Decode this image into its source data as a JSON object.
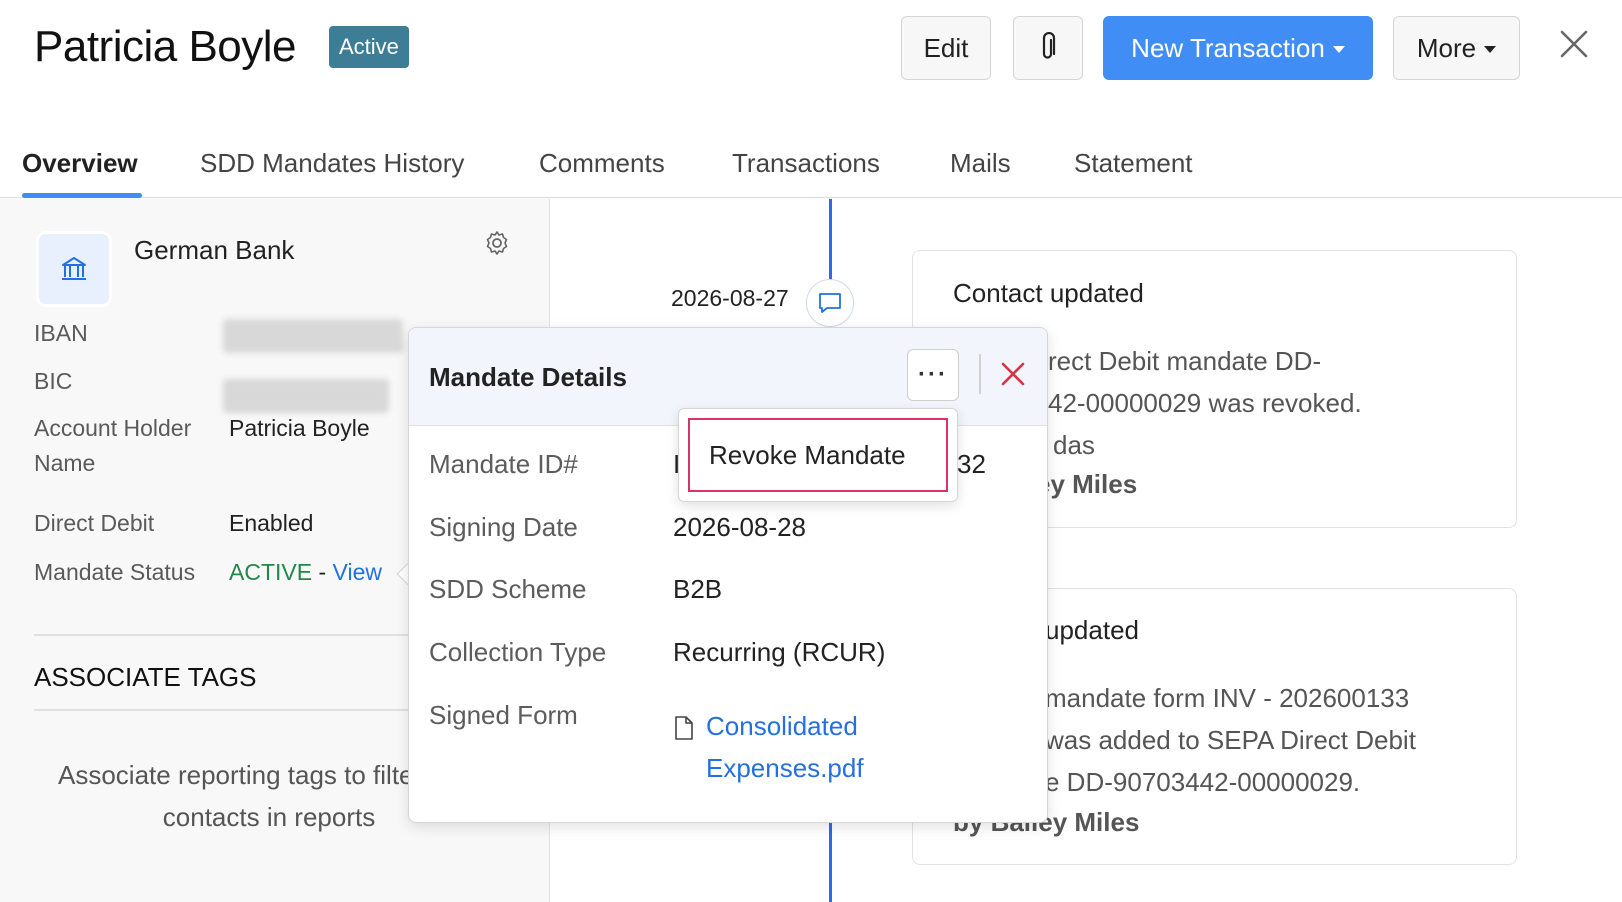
{
  "header": {
    "title": "Patricia Boyle",
    "status_badge": "Active",
    "edit_label": "Edit",
    "attach_icon": "paperclip-icon",
    "new_transaction_label": "New Transaction",
    "more_label": "More",
    "close_icon": "close-icon"
  },
  "tabs": [
    {
      "label": "Overview",
      "active": true
    },
    {
      "label": "SDD Mandates History"
    },
    {
      "label": "Comments"
    },
    {
      "label": "Transactions"
    },
    {
      "label": "Mails"
    },
    {
      "label": "Statement"
    }
  ],
  "bank": {
    "name": "German Bank",
    "icon": "bank-icon",
    "fields": {
      "iban_label": "IBAN",
      "bic_label": "BIC",
      "holder_label": "Account Holder Name",
      "holder_value": "Patricia Boyle",
      "direct_debit_label": "Direct Debit",
      "direct_debit_value": "Enabled",
      "mandate_status_label": "Mandate Status",
      "mandate_status_value": "ACTIVE",
      "mandate_status_sep": "-",
      "mandate_view_link": "View"
    }
  },
  "tags": {
    "title": "ASSOCIATE TAGS",
    "hint": "Associate reporting tags to filter your contacts in reports"
  },
  "timeline": {
    "date": "2026-08-27",
    "cards": [
      {
        "title": "Contact updated",
        "body_lines": [
          "rect Debit mandate DD-",
          "42-00000029 was revoked.",
          "das"
        ],
        "by": "ey Miles"
      },
      {
        "title": "updated",
        "body_lines": [
          "mandate form INV - 202600133",
          "was added to SEPA Direct Debit",
          "e DD-90703442-00000029."
        ],
        "by": "by Bailey Miles"
      }
    ]
  },
  "mandate_popover": {
    "title": "Mandate Details",
    "rows": {
      "mandate_id_label": "Mandate ID#",
      "mandate_id_value_end": "32",
      "signing_date_label": "Signing Date",
      "signing_date_value": "2026-08-28",
      "scheme_label": "SDD Scheme",
      "scheme_value": "B2B",
      "collection_label": "Collection Type",
      "collection_value": "Recurring (RCUR)",
      "signed_form_label": "Signed Form",
      "signed_form_line1": "Consolidated",
      "signed_form_line2": "Expenses.pdf"
    },
    "menu": {
      "revoke_label": "Revoke Mandate"
    }
  },
  "colors": {
    "accent": "#408df5",
    "badge": "#3d7d95",
    "active_status": "#23874a",
    "danger": "#d6336c"
  }
}
